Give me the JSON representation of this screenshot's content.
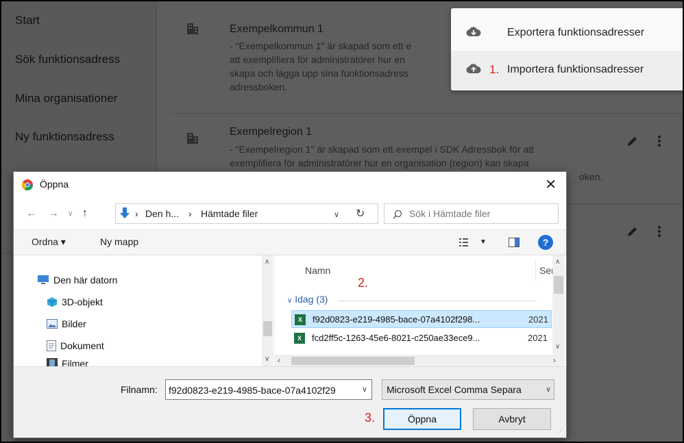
{
  "sidebar": {
    "items": [
      {
        "label": "Start"
      },
      {
        "label": "Sök funktionsadress"
      },
      {
        "label": "Mina organisationer"
      },
      {
        "label": "Ny funktionsadress"
      }
    ]
  },
  "organizations": [
    {
      "title": "Exempelkommun 1",
      "description_lines": [
        " - \"Exempelkommun 1\" är skapad som ett e",
        "att exemplifiera för administratörer hur en",
        "skapa och lägga upp sina funktionsadress",
        "adressboken."
      ]
    },
    {
      "title": "Exempelregion 1",
      "description_lines": [
        " - \"Exempelregion 1\" är skapad som ett exempel i SDK Adressbok för att",
        "exemplifiera för administratörer hur en organisation (region) kan skapa",
        "oken."
      ]
    }
  ],
  "menu": {
    "export_label": "Exportera funktionsadresser",
    "import_label": "Importera funktionsadresser",
    "import_step": "1."
  },
  "dialog": {
    "title": "Öppna",
    "close": "✕",
    "breadcrumb": [
      "Den h...",
      "Hämtade filer"
    ],
    "search_placeholder": "Sök i Hämtade filer",
    "toolbar": {
      "organize": "Ordna ▾",
      "new_folder": "Ny mapp",
      "help": "?"
    },
    "tree": [
      {
        "label": "Den här datorn",
        "icon": "computer-icon"
      },
      {
        "label": "3D-objekt",
        "icon": "cube-icon"
      },
      {
        "label": "Bilder",
        "icon": "pictures-icon"
      },
      {
        "label": "Dokument",
        "icon": "document-icon"
      },
      {
        "label": "Filmer",
        "icon": "film-icon"
      }
    ],
    "columns": {
      "name": "Namn",
      "date": "Sena"
    },
    "step2": "2.",
    "group_label": "Idag (3)",
    "files": [
      {
        "name": "f92d0823-e219-4985-bace-07a4102f298...",
        "date": "2021",
        "selected": true
      },
      {
        "name": "fcd2ff5c-1263-45e6-8021-c250ae33ece9...",
        "date": "2021",
        "selected": false
      }
    ],
    "filename_label": "Filnamn:",
    "filename_value": "f92d0823-e219-4985-bace-07a4102f29",
    "filetype": "Microsoft Excel Comma Separa",
    "step3": "3.",
    "open_button": "Öppna",
    "cancel_button": "Avbryt"
  },
  "colors": {
    "accent_red": "#d7211b",
    "selection_blue": "#cce8ff",
    "win_blue": "#0078d7"
  }
}
